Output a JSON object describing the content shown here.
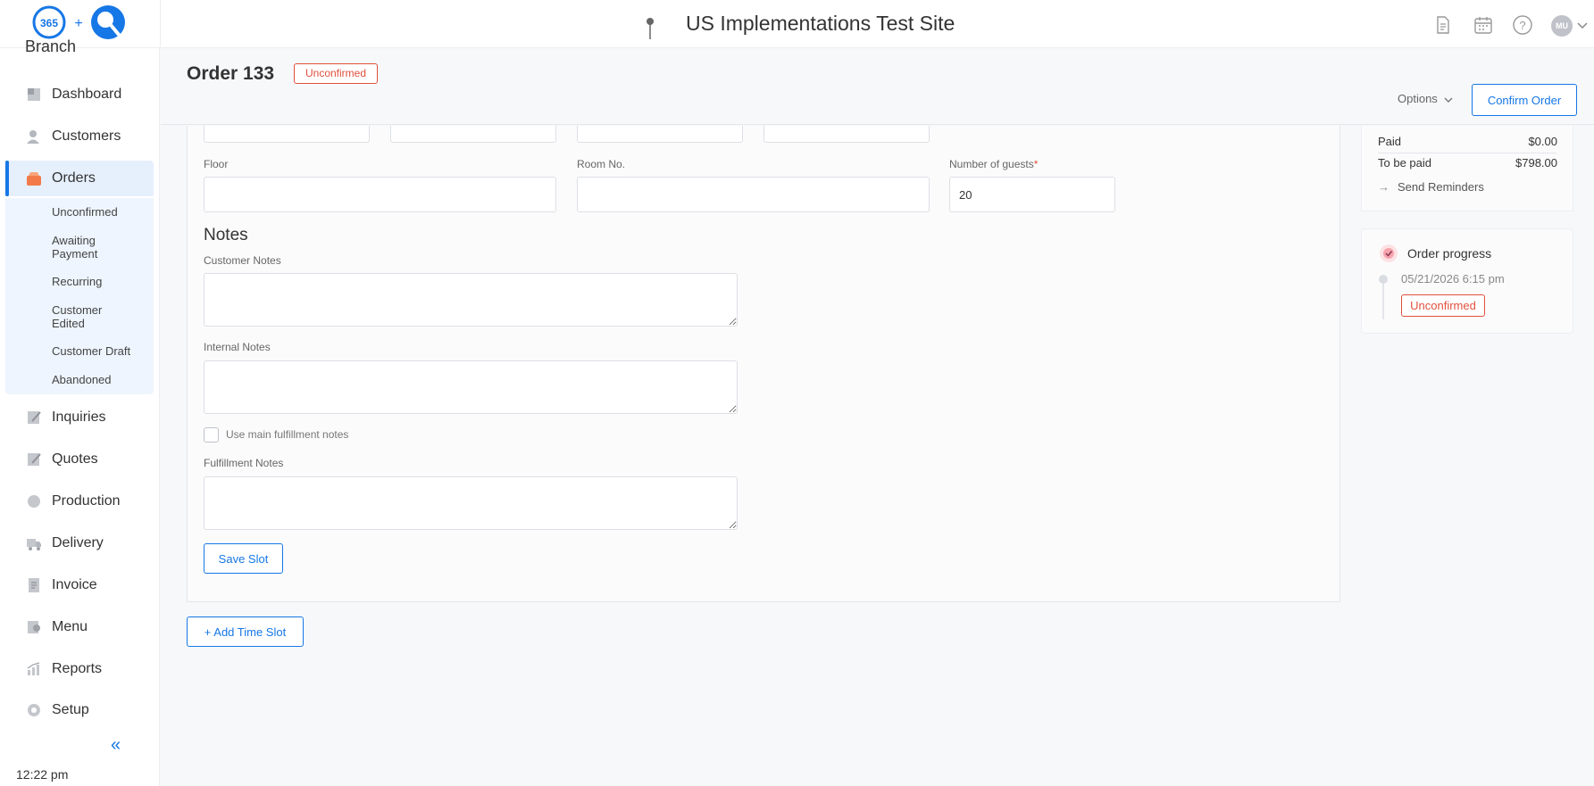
{
  "topbar": {
    "logo_text": "365",
    "logo_plus": "+",
    "site_title": "US Implementations Test Site",
    "avatar_initials": "MU",
    "icons": [
      "document-icon",
      "calendar-icon",
      "help-icon"
    ]
  },
  "sidebar": {
    "branch_label": "Branch",
    "items": [
      {
        "label": "Dashboard",
        "icon": "dashboard-icon"
      },
      {
        "label": "Customers",
        "icon": "customers-icon"
      },
      {
        "label": "Orders",
        "icon": "orders-icon",
        "active": true
      },
      {
        "label": "Inquiries",
        "icon": "inquiries-icon"
      },
      {
        "label": "Quotes",
        "icon": "quotes-icon"
      },
      {
        "label": "Production",
        "icon": "production-icon"
      },
      {
        "label": "Delivery",
        "icon": "delivery-icon"
      },
      {
        "label": "Invoice",
        "icon": "invoice-icon"
      },
      {
        "label": "Menu",
        "icon": "menu-icon"
      },
      {
        "label": "Reports",
        "icon": "reports-icon"
      },
      {
        "label": "Setup",
        "icon": "setup-icon"
      }
    ],
    "order_subitems": [
      {
        "line1": "Unconfirmed",
        "line2": ""
      },
      {
        "line1": "Awaiting",
        "line2": "Payment"
      },
      {
        "line1": "Recurring",
        "line2": ""
      },
      {
        "line1": "Customer",
        "line2": "Edited"
      },
      {
        "line1": "Customer Draft",
        "line2": ""
      },
      {
        "line1": "Abandoned",
        "line2": ""
      }
    ],
    "collapse_glyph": "«",
    "clock": "12:22 pm"
  },
  "header": {
    "order_title": "Order 133",
    "status_badge": "Unconfirmed",
    "options_label": "Options",
    "confirm_label": "Confirm Order"
  },
  "form": {
    "floor_label": "Floor",
    "floor_value": "",
    "room_label": "Room No.",
    "room_value": "",
    "guests_label": "Number of guests",
    "guests_required": "*",
    "guests_value": "20",
    "notes_title": "Notes",
    "customer_notes_label": "Customer Notes",
    "internal_notes_label": "Internal Notes",
    "use_main_label": "Use main fulfillment notes",
    "use_main_checked": false,
    "fulfillment_notes_label": "Fulfillment Notes",
    "save_slot_label": "Save Slot",
    "add_time_slot_label": "+ Add Time Slot"
  },
  "payment": {
    "paid_label": "Paid",
    "paid_value": "$0.00",
    "to_be_paid_label": "To be paid",
    "to_be_paid_value": "$798.00",
    "reminders_arrow": "→",
    "reminders_label": "Send Reminders"
  },
  "progress": {
    "title": "Order progress",
    "date": "05/21/2026 6:15 pm",
    "status": "Unconfirmed"
  },
  "colors": {
    "accent": "#1677e6",
    "danger": "#e0503c",
    "active_bg": "#e6f0fd"
  }
}
